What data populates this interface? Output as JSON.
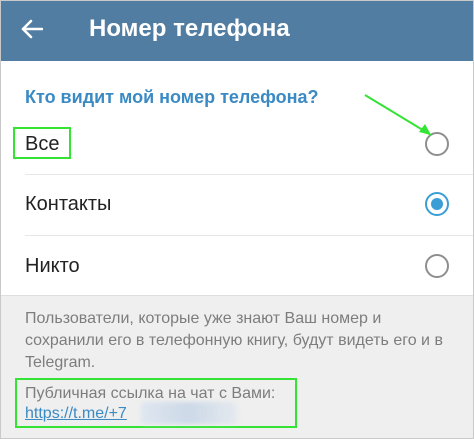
{
  "header": {
    "title": "Номер телефона",
    "icon": "arrow-left",
    "color": "#517da2"
  },
  "section": {
    "label": "Кто видит мой номер телефона?"
  },
  "options": [
    {
      "label": "Все",
      "selected": false
    },
    {
      "label": "Контакты",
      "selected": true
    },
    {
      "label": "Никто",
      "selected": false
    }
  ],
  "footer": {
    "description": "Пользователи, которые уже знают Ваш номер и сохранили его в телефонную книгу, будут видеть его и в Telegram.",
    "link_label": "Публичная ссылка на чат с Вами:",
    "link_url": "https://t.me/+7"
  },
  "colors": {
    "accent": "#3a9ed6",
    "highlight": "#34e334"
  }
}
